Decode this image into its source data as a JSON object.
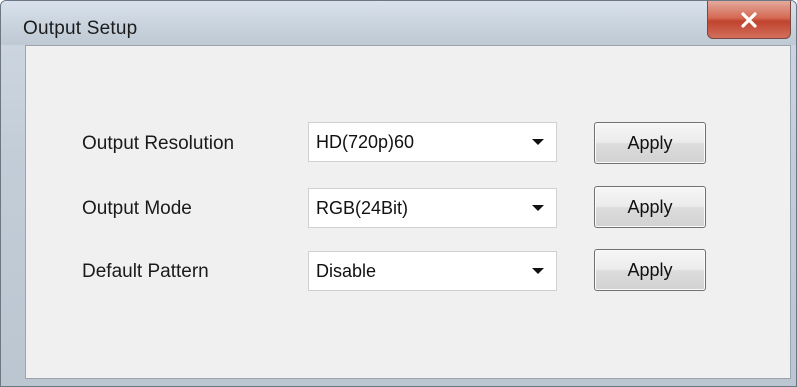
{
  "window": {
    "title": "Output Setup",
    "close_icon": "close-icon"
  },
  "rows": [
    {
      "label": "Output Resolution",
      "value": "HD(720p)60",
      "button": "Apply"
    },
    {
      "label": "Output Mode",
      "value": "RGB(24Bit)",
      "button": "Apply"
    },
    {
      "label": "Default Pattern",
      "value": "Disable",
      "button": "Apply"
    }
  ],
  "colors": {
    "close_button": "#c0432d",
    "client_background": "#f0f0f0"
  }
}
